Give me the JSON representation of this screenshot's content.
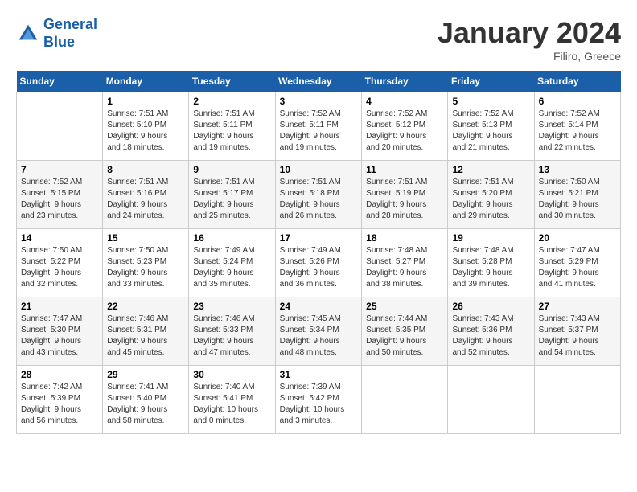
{
  "header": {
    "logo_line1": "General",
    "logo_line2": "Blue",
    "month_title": "January 2024",
    "location": "Filiro, Greece"
  },
  "weekdays": [
    "Sunday",
    "Monday",
    "Tuesday",
    "Wednesday",
    "Thursday",
    "Friday",
    "Saturday"
  ],
  "weeks": [
    [
      {
        "day": "",
        "info": ""
      },
      {
        "day": "1",
        "info": "Sunrise: 7:51 AM\nSunset: 5:10 PM\nDaylight: 9 hours\nand 18 minutes."
      },
      {
        "day": "2",
        "info": "Sunrise: 7:51 AM\nSunset: 5:11 PM\nDaylight: 9 hours\nand 19 minutes."
      },
      {
        "day": "3",
        "info": "Sunrise: 7:52 AM\nSunset: 5:11 PM\nDaylight: 9 hours\nand 19 minutes."
      },
      {
        "day": "4",
        "info": "Sunrise: 7:52 AM\nSunset: 5:12 PM\nDaylight: 9 hours\nand 20 minutes."
      },
      {
        "day": "5",
        "info": "Sunrise: 7:52 AM\nSunset: 5:13 PM\nDaylight: 9 hours\nand 21 minutes."
      },
      {
        "day": "6",
        "info": "Sunrise: 7:52 AM\nSunset: 5:14 PM\nDaylight: 9 hours\nand 22 minutes."
      }
    ],
    [
      {
        "day": "7",
        "info": "Sunrise: 7:52 AM\nSunset: 5:15 PM\nDaylight: 9 hours\nand 23 minutes."
      },
      {
        "day": "8",
        "info": "Sunrise: 7:51 AM\nSunset: 5:16 PM\nDaylight: 9 hours\nand 24 minutes."
      },
      {
        "day": "9",
        "info": "Sunrise: 7:51 AM\nSunset: 5:17 PM\nDaylight: 9 hours\nand 25 minutes."
      },
      {
        "day": "10",
        "info": "Sunrise: 7:51 AM\nSunset: 5:18 PM\nDaylight: 9 hours\nand 26 minutes."
      },
      {
        "day": "11",
        "info": "Sunrise: 7:51 AM\nSunset: 5:19 PM\nDaylight: 9 hours\nand 28 minutes."
      },
      {
        "day": "12",
        "info": "Sunrise: 7:51 AM\nSunset: 5:20 PM\nDaylight: 9 hours\nand 29 minutes."
      },
      {
        "day": "13",
        "info": "Sunrise: 7:50 AM\nSunset: 5:21 PM\nDaylight: 9 hours\nand 30 minutes."
      }
    ],
    [
      {
        "day": "14",
        "info": "Sunrise: 7:50 AM\nSunset: 5:22 PM\nDaylight: 9 hours\nand 32 minutes."
      },
      {
        "day": "15",
        "info": "Sunrise: 7:50 AM\nSunset: 5:23 PM\nDaylight: 9 hours\nand 33 minutes."
      },
      {
        "day": "16",
        "info": "Sunrise: 7:49 AM\nSunset: 5:24 PM\nDaylight: 9 hours\nand 35 minutes."
      },
      {
        "day": "17",
        "info": "Sunrise: 7:49 AM\nSunset: 5:26 PM\nDaylight: 9 hours\nand 36 minutes."
      },
      {
        "day": "18",
        "info": "Sunrise: 7:48 AM\nSunset: 5:27 PM\nDaylight: 9 hours\nand 38 minutes."
      },
      {
        "day": "19",
        "info": "Sunrise: 7:48 AM\nSunset: 5:28 PM\nDaylight: 9 hours\nand 39 minutes."
      },
      {
        "day": "20",
        "info": "Sunrise: 7:47 AM\nSunset: 5:29 PM\nDaylight: 9 hours\nand 41 minutes."
      }
    ],
    [
      {
        "day": "21",
        "info": "Sunrise: 7:47 AM\nSunset: 5:30 PM\nDaylight: 9 hours\nand 43 minutes."
      },
      {
        "day": "22",
        "info": "Sunrise: 7:46 AM\nSunset: 5:31 PM\nDaylight: 9 hours\nand 45 minutes."
      },
      {
        "day": "23",
        "info": "Sunrise: 7:46 AM\nSunset: 5:33 PM\nDaylight: 9 hours\nand 47 minutes."
      },
      {
        "day": "24",
        "info": "Sunrise: 7:45 AM\nSunset: 5:34 PM\nDaylight: 9 hours\nand 48 minutes."
      },
      {
        "day": "25",
        "info": "Sunrise: 7:44 AM\nSunset: 5:35 PM\nDaylight: 9 hours\nand 50 minutes."
      },
      {
        "day": "26",
        "info": "Sunrise: 7:43 AM\nSunset: 5:36 PM\nDaylight: 9 hours\nand 52 minutes."
      },
      {
        "day": "27",
        "info": "Sunrise: 7:43 AM\nSunset: 5:37 PM\nDaylight: 9 hours\nand 54 minutes."
      }
    ],
    [
      {
        "day": "28",
        "info": "Sunrise: 7:42 AM\nSunset: 5:39 PM\nDaylight: 9 hours\nand 56 minutes."
      },
      {
        "day": "29",
        "info": "Sunrise: 7:41 AM\nSunset: 5:40 PM\nDaylight: 9 hours\nand 58 minutes."
      },
      {
        "day": "30",
        "info": "Sunrise: 7:40 AM\nSunset: 5:41 PM\nDaylight: 10 hours\nand 0 minutes."
      },
      {
        "day": "31",
        "info": "Sunrise: 7:39 AM\nSunset: 5:42 PM\nDaylight: 10 hours\nand 3 minutes."
      },
      {
        "day": "",
        "info": ""
      },
      {
        "day": "",
        "info": ""
      },
      {
        "day": "",
        "info": ""
      }
    ]
  ]
}
